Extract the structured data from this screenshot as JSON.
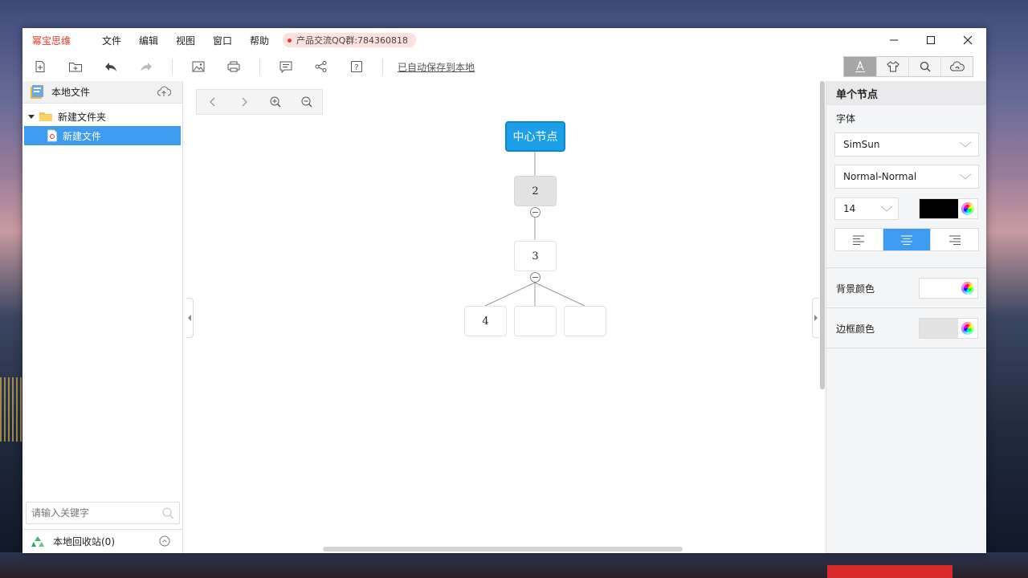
{
  "titlebar": {
    "app_name": "幂宝思维",
    "menu": [
      "文件",
      "编辑",
      "视图",
      "窗口",
      "帮助"
    ],
    "qq_badge": "产品交流QQ群:784360818"
  },
  "toolbar": {
    "autosave_label": "已自动保存到本地"
  },
  "sidebar": {
    "header_label": "本地文件",
    "folder_label": "新建文件夹",
    "file_label": "新建文件",
    "search_placeholder": "请输入关键字",
    "recycle_label": "本地回收站(0)"
  },
  "mindmap": {
    "center_label": "中心节点",
    "node2_label": "2",
    "node3_label": "3",
    "node4_label": "4",
    "node5_label": "",
    "node6_label": ""
  },
  "panel": {
    "title": "单个节点",
    "font_label": "字体",
    "font_family": "SimSun",
    "font_style": "Normal-Normal",
    "font_size": "14",
    "font_color": "#000000",
    "bg_color_label": "背景颜色",
    "bg_color": "#ffffff",
    "border_color_label": "边框颜色",
    "border_color": "#e2e2e2"
  },
  "colors": {
    "accent": "#3d9bf0",
    "center_node": "#1d9fe8",
    "brand": "#e23b2e"
  }
}
